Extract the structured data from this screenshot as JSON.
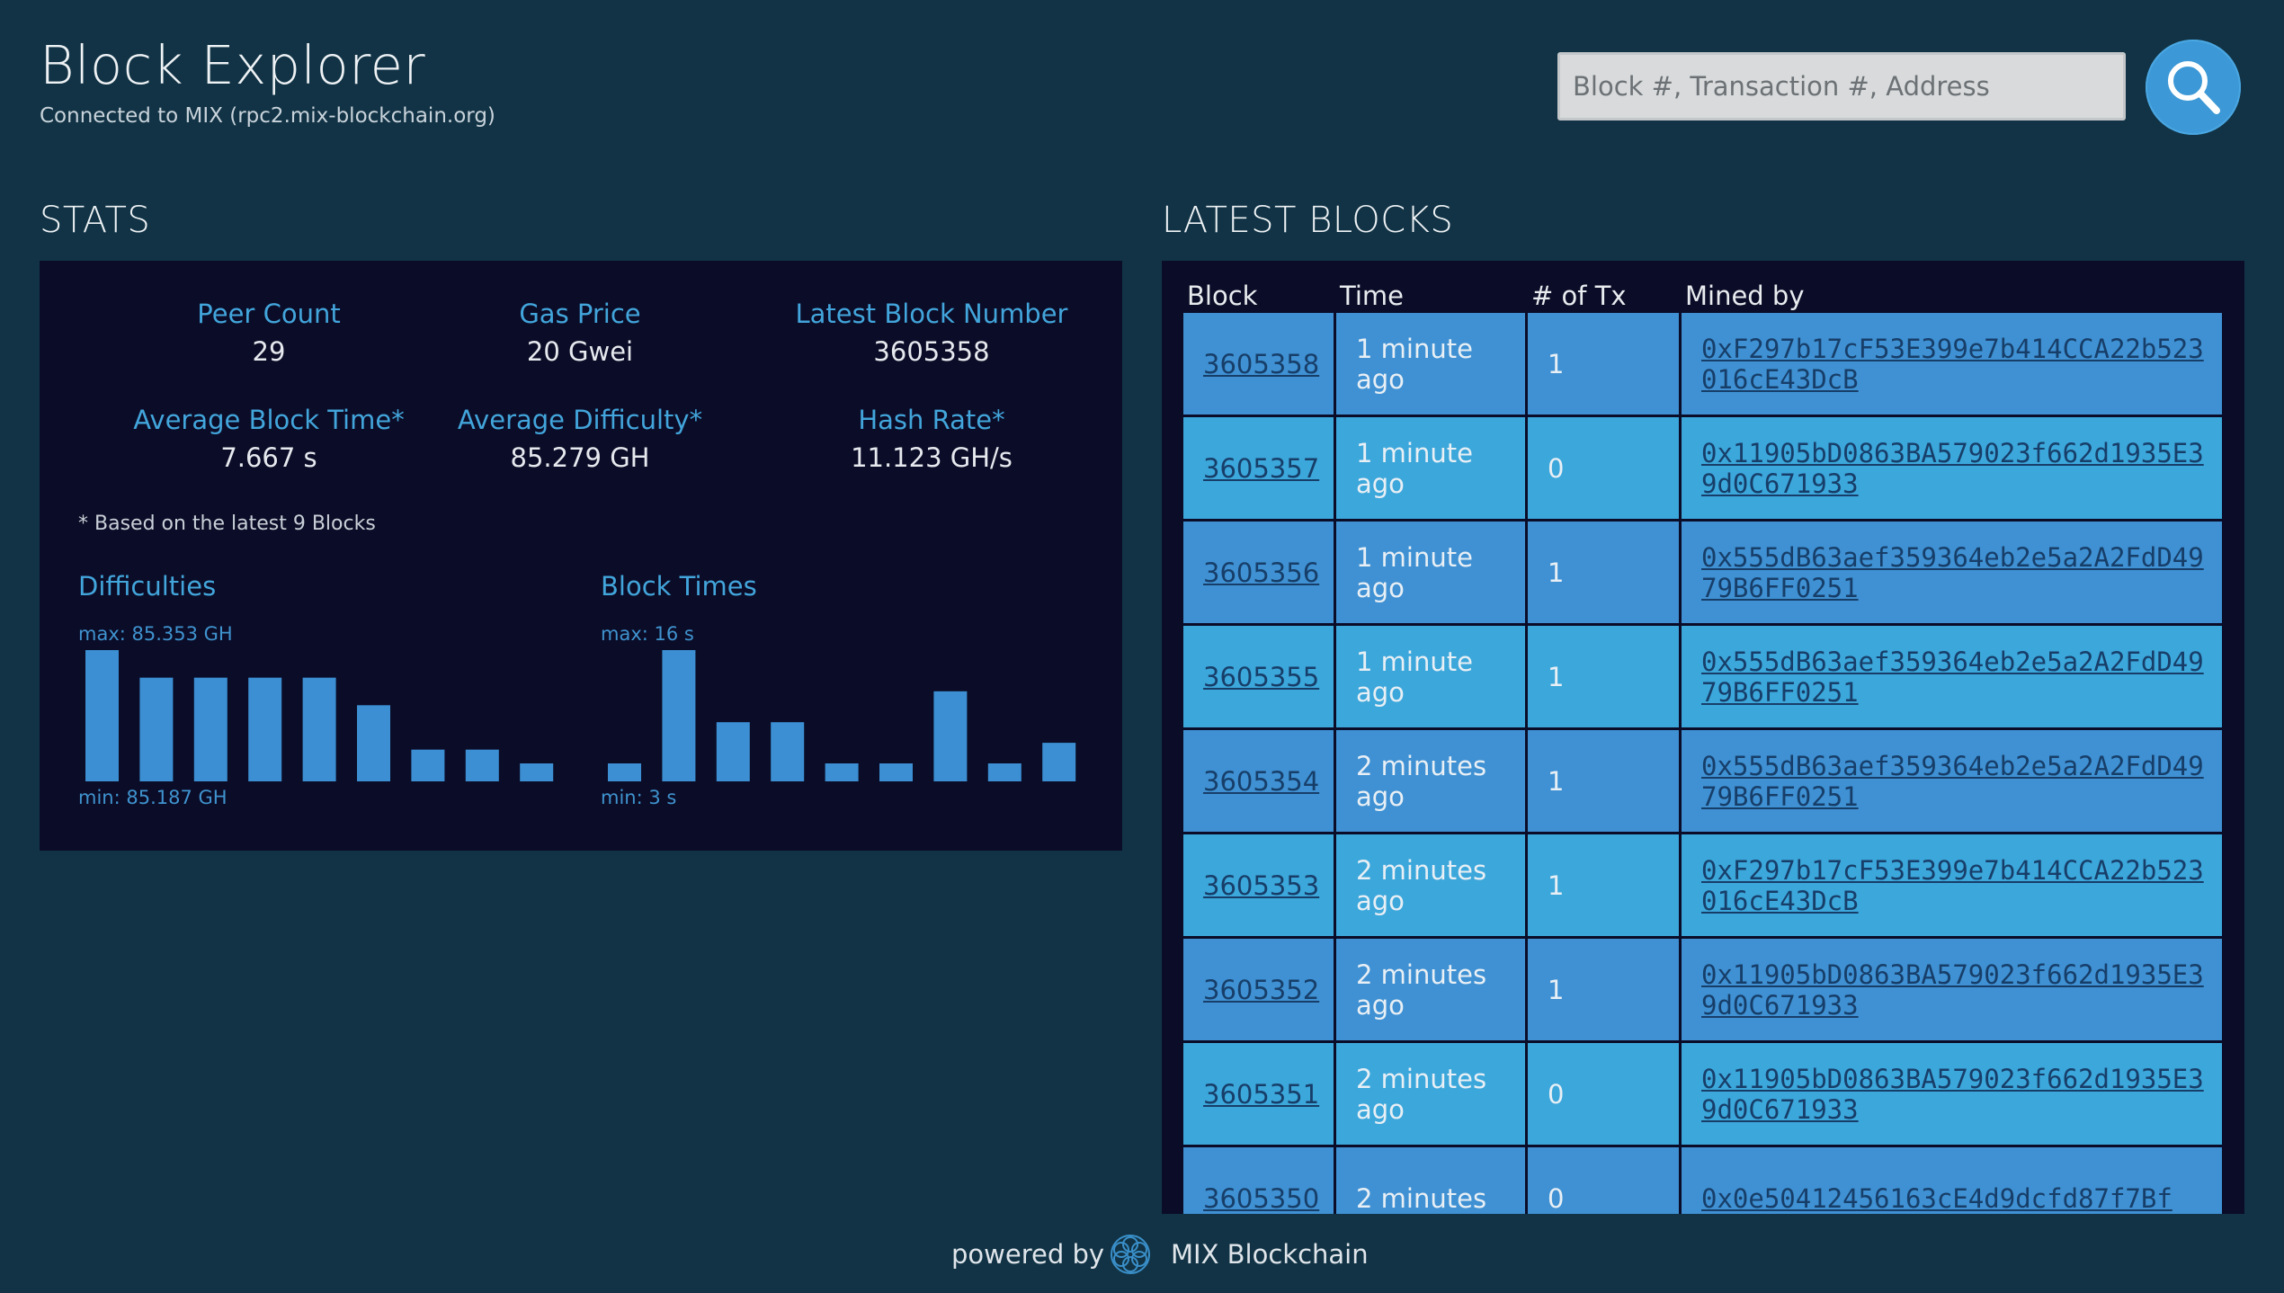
{
  "header": {
    "title": "Block Explorer",
    "subtitle": "Connected to MIX (rpc2.mix-blockchain.org)",
    "search_placeholder": "Block #, Transaction #, Address",
    "search_icon": "search-icon"
  },
  "stats": {
    "title": "STATS",
    "items": [
      {
        "label": "Peer Count",
        "value": "29"
      },
      {
        "label": "Gas Price",
        "value": "20 Gwei"
      },
      {
        "label": "Latest Block Number",
        "value": "3605358"
      },
      {
        "label": "Average Block Time*",
        "value": "7.667 s"
      },
      {
        "label": "Average Difficulty*",
        "value": "85.279 GH"
      },
      {
        "label": "Hash Rate*",
        "value": "11.123 GH/s"
      }
    ],
    "footnote": "* Based on the latest 9 Blocks",
    "charts": [
      {
        "title": "Difficulties",
        "max_label": "max: 85.353 GH",
        "min_label": "min: 85.187 GH",
        "bar_color": "#3b8fd2",
        "values": [
          85.353,
          85.317,
          85.317,
          85.317,
          85.317,
          85.281,
          85.223,
          85.223,
          85.205
        ]
      },
      {
        "title": "Block Times",
        "max_label": "max: 16 s",
        "min_label": "min: 3 s",
        "bar_color": "#3b8fd2",
        "values": [
          5,
          16,
          9,
          9,
          5,
          5,
          12,
          5,
          7
        ]
      }
    ]
  },
  "blocks": {
    "title": "LATEST BLOCKS",
    "columns": [
      "Block",
      "Time",
      "# of Tx",
      "Mined by"
    ],
    "rows": [
      {
        "block": "3605358",
        "time": "1 minute ago",
        "tx": "1",
        "miner": "0xF297b17cF53E399e7b414CCA22b523016cE43DcB"
      },
      {
        "block": "3605357",
        "time": "1 minute ago",
        "tx": "0",
        "miner": "0x11905bD0863BA579023f662d1935E39d0C671933"
      },
      {
        "block": "3605356",
        "time": "1 minute ago",
        "tx": "1",
        "miner": "0x555dB63aef359364eb2e5a2A2FdD4979B6FF0251"
      },
      {
        "block": "3605355",
        "time": "1 minute ago",
        "tx": "1",
        "miner": "0x555dB63aef359364eb2e5a2A2FdD4979B6FF0251"
      },
      {
        "block": "3605354",
        "time": "2 minutes ago",
        "tx": "1",
        "miner": "0x555dB63aef359364eb2e5a2A2FdD4979B6FF0251"
      },
      {
        "block": "3605353",
        "time": "2 minutes ago",
        "tx": "1",
        "miner": "0xF297b17cF53E399e7b414CCA22b523016cE43DcB"
      },
      {
        "block": "3605352",
        "time": "2 minutes ago",
        "tx": "1",
        "miner": "0x11905bD0863BA579023f662d1935E39d0C671933"
      },
      {
        "block": "3605351",
        "time": "2 minutes ago",
        "tx": "0",
        "miner": "0x11905bD0863BA579023f662d1935E39d0C671933"
      },
      {
        "block": "3605350",
        "time": "2 minutes",
        "tx": "0",
        "miner": "0x0e50412456163cE4d9dcfd87f7Bf"
      }
    ]
  },
  "footer": {
    "powered_by": "powered by",
    "brand": "MIX Blockchain",
    "logo_icon": "mix-logo-icon"
  },
  "colors": {
    "background": "#113345",
    "panel": "#0b0c27",
    "accent": "#42a5db",
    "row_odd": "#3f91d3",
    "row_even": "#3ca7db",
    "link": "#173e69"
  }
}
